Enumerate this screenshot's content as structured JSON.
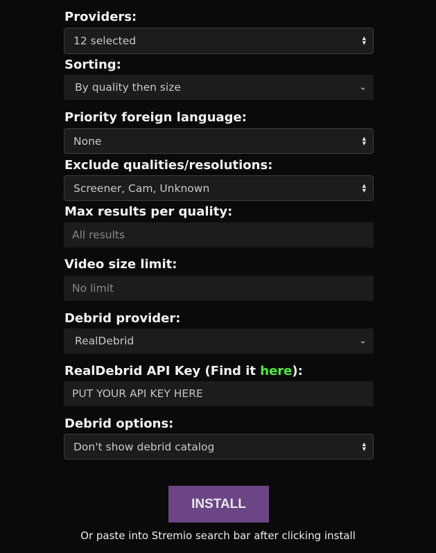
{
  "providers": {
    "label": "Providers:",
    "value": "12 selected"
  },
  "sorting": {
    "label": "Sorting:",
    "value": "By quality then size"
  },
  "language": {
    "label": "Priority foreign language:",
    "value": "None"
  },
  "exclude": {
    "label": "Exclude qualities/resolutions:",
    "value": "Screener, Cam, Unknown"
  },
  "max_results": {
    "label": "Max results per quality:",
    "placeholder": "All results"
  },
  "size_limit": {
    "label": "Video size limit:",
    "placeholder": "No limit"
  },
  "debrid_provider": {
    "label": "Debrid provider:",
    "value": "RealDebrid"
  },
  "api_key": {
    "label_prefix": "RealDebrid API Key (Find it ",
    "link": "here",
    "label_suffix": "):",
    "value": "PUT YOUR API KEY HERE"
  },
  "debrid_options": {
    "label": "Debrid options:",
    "value": "Don't show debrid catalog"
  },
  "install": {
    "label": "INSTALL",
    "note": "Or paste into Stremio search bar after clicking install"
  },
  "colors": {
    "background": "#0a0a0a",
    "field": "#1b1c1e",
    "link": "#4cf03a",
    "button": "#6b4585"
  }
}
